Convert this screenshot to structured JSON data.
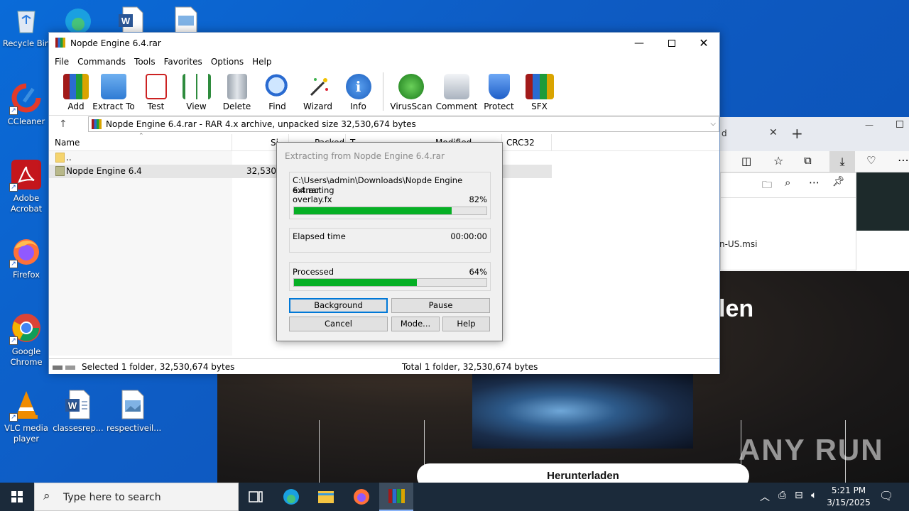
{
  "desktop": {
    "icons": [
      {
        "label": "Recycle Bin"
      },
      {
        "label": "CCleaner"
      },
      {
        "label": "Adobe Acrobat"
      },
      {
        "label": "Firefox"
      },
      {
        "label": "Google Chrome"
      },
      {
        "label": "VLC media player"
      },
      {
        "label": "classesrep..."
      },
      {
        "label": "respectiveil..."
      }
    ]
  },
  "browser": {
    "tab_fragment": "d",
    "download_fragment": "n-US.msi",
    "page_heading_fragment": "len",
    "download_button": "Herunterladen",
    "watermark": "ANY RUN"
  },
  "winrar": {
    "title": "Nopde Engine 6.4.rar",
    "menu": [
      "File",
      "Commands",
      "Tools",
      "Favorites",
      "Options",
      "Help"
    ],
    "toolbar": [
      "Add",
      "Extract To",
      "Test",
      "View",
      "Delete",
      "Find",
      "Wizard",
      "Info",
      "VirusScan",
      "Comment",
      "Protect",
      "SFX"
    ],
    "address": "Nopde Engine 6.4.rar - RAR 4.x archive, unpacked size 32,530,674 bytes",
    "columns": {
      "name": "Name",
      "size": "Si",
      "packed": "Packed",
      "type": "T",
      "modified": "Modified",
      "crc": "CRC32"
    },
    "rows": [
      {
        "name": "..",
        "size": ""
      },
      {
        "name": "Nopde Engine 6.4",
        "size": "32,530,6"
      }
    ],
    "status_left": "Selected 1 folder, 32,530,674 bytes",
    "status_right": "Total 1 folder, 32,530,674 bytes"
  },
  "dialog": {
    "title": "Extracting from Nopde Engine 6.4.rar",
    "path": "C:\\Users\\admin\\Downloads\\Nopde Engine 6.4.rar",
    "action": "extracting",
    "file": "overlay.fx",
    "file_percent": "82%",
    "file_progress": 0.82,
    "elapsed_label": "Elapsed time",
    "elapsed_value": "00:00:00",
    "processed_label": "Processed",
    "processed_percent": "64%",
    "processed_progress": 0.64,
    "buttons": {
      "background": "Background",
      "pause": "Pause",
      "cancel": "Cancel",
      "mode": "Mode...",
      "help": "Help"
    }
  },
  "taskbar": {
    "search_placeholder": "Type here to search",
    "time": "5:21 PM",
    "date": "3/15/2025"
  }
}
